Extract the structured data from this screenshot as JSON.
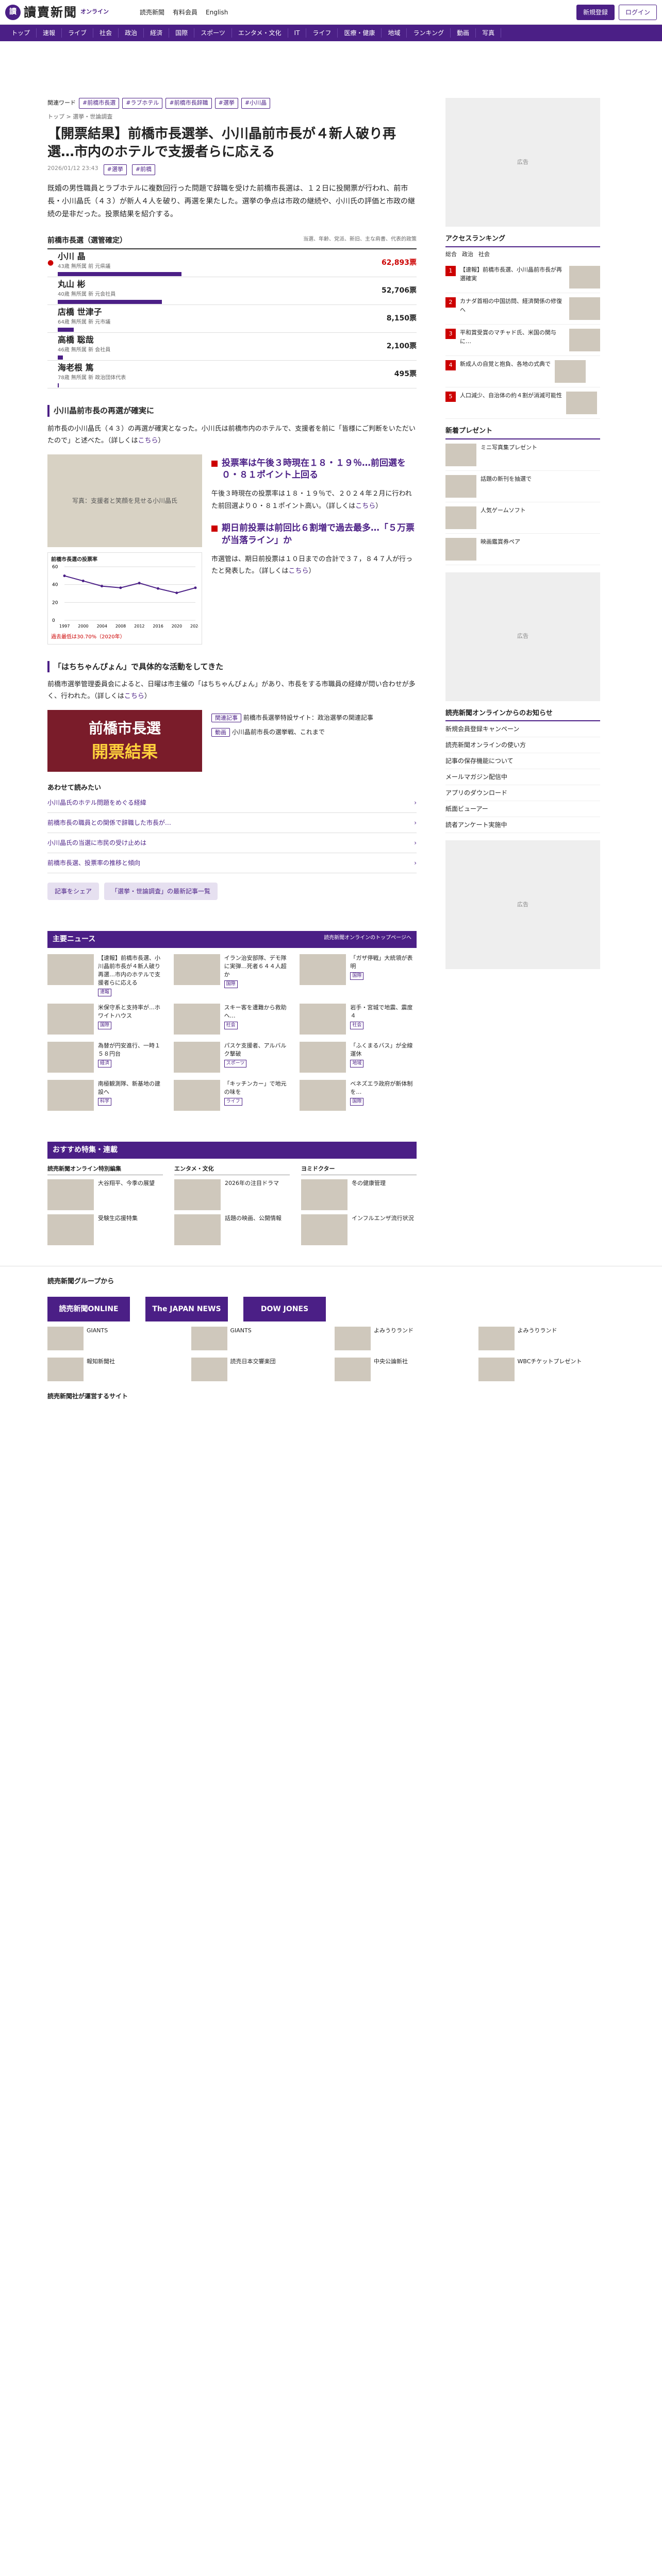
{
  "header": {
    "logo_mark": "讀",
    "logo": "讀賣新聞",
    "logo_sub": "オンライン",
    "links": [
      "読売新聞",
      "有料会員",
      "English"
    ],
    "login": "ログイン",
    "register": "新規登録"
  },
  "nav": [
    "トップ",
    "速報",
    "ライブ",
    "社会",
    "政治",
    "経済",
    "国際",
    "スポーツ",
    "エンタメ・文化",
    "IT",
    "ライフ",
    "医療・健康",
    "地域",
    "ランキング",
    "動画",
    "写真"
  ],
  "keywords": {
    "label": "関連ワード",
    "tags": [
      "#前橋市長選",
      "#ラブホテル",
      "#前橋市長辞職",
      "#選挙",
      "#小川晶"
    ]
  },
  "breadcrumb": "トップ > 選挙・世論調査",
  "title": "【開票結果】前橋市長選挙、小川晶前市長が４新人破り再選…市内のホテルで支援者らに応える",
  "meta": {
    "date": "2026/01/12 23:43",
    "tags": [
      "#選挙",
      "#前橋"
    ]
  },
  "lead": "既婚の男性職員とラブホテルに複数回行った問題で辞職を受けた前橋市長選は、１２日に投開票が行われ、前市長・小川晶氏（４３）が新人４人を破り、再選を果たした。選挙の争点は市政の継続や、小川氏の評価と市政の継続の是非だった。投票結果を紹介する。",
  "results": {
    "title": "前橋市長選（選管確定）",
    "note": "当選、年齢、党派、新旧、主な肩書、代表的政策",
    "candidates": [
      {
        "name": "小川 晶",
        "sub": "43歳 無所属 前 元県議",
        "votes": "62,893票",
        "pct": 100,
        "win": true
      },
      {
        "name": "丸山 彬",
        "sub": "40歳 無所属 新 元会社員",
        "votes": "52,706票",
        "pct": 84,
        "win": false
      },
      {
        "name": "店橋 世津子",
        "sub": "64歳 無所属 新 元市議",
        "votes": "8,150票",
        "pct": 13,
        "win": false
      },
      {
        "name": "高橋 聡哉",
        "sub": "46歳 無所属 新 会社員",
        "votes": "2,100票",
        "pct": 4,
        "win": false
      },
      {
        "name": "海老根 篤",
        "sub": "78歳 無所属 新 政治団体代表",
        "votes": "495票",
        "pct": 1,
        "win": false
      }
    ]
  },
  "sec1": {
    "heading": "小川晶前市長の再選が確実に",
    "text": "前市長の小川晶氏（４３）の再選が確実となった。小川氏は前橋市内のホテルで、支援者を前に「皆様にご判断をいただいたので」と述べた。（詳しくは",
    "link": "こちら",
    "close": "）"
  },
  "photo1": "写真：支援者と笑顔を見せる小川晶氏",
  "turnout": {
    "title": "投票率は午後３時現在１８・１９％…前回選を０・８１ポイント上回る",
    "text": "午後３時現在の投票率は１８・１９％で、２０２４年２月に行われた前回選より０・８１ポイント高い。（詳しくは",
    "link": "こちら",
    "close": "）",
    "title2": "期日前投票は前回比６割増で過去最多…「５万票が当落ライン」か",
    "text2": "市選管は、期日前投票は１０日までの合計で３７，８４７人が行ったと発表した。（詳しくは",
    "link2": "こちら",
    "close2": "）"
  },
  "chart_data": {
    "type": "line",
    "title": "前橋市長選の投票率",
    "x": [
      "1997",
      "2000",
      "2004",
      "2008",
      "2012",
      "2016",
      "2020",
      "2024"
    ],
    "values": [
      49.8,
      44.1,
      38.3,
      36.4,
      41.7,
      35.6,
      30.7,
      36.4
    ],
    "ylim": [
      0,
      60
    ],
    "annotation": "過去最低は30.70%（2020年）"
  },
  "sec2": {
    "heading": "「はちちゃんぴょん」で具体的な活動をしてきた",
    "text": "前橋市選挙管理委員会によると、日曜は市主催の「はちちゃんぴょん」があり、市長をする市職員の経緯が問い合わせが多く、行われた。（詳しくは",
    "link": "こちら",
    "close": "）"
  },
  "poster": {
    "line1": "前橋市長選",
    "line2": "開票結果"
  },
  "mini": [
    {
      "tag": "関連記事",
      "title": "前橋市長選挙特設サイト：政治選挙の関連記事"
    },
    {
      "tag": "動画",
      "title": "小川晶前市長の選挙戦、これまで"
    }
  ],
  "related": {
    "heading": "あわせて読みたい",
    "items": [
      "小川晶氏のホテル問題をめぐる経緯",
      "前橋市長の職員との関係で辞職した市長が…",
      "小川晶氏の当選に市民の受け止めは",
      "前橋市長選、投票率の推移と傾向"
    ]
  },
  "share": [
    "記事をシェア",
    "「選挙・世論調査」の最新記事一覧"
  ],
  "main_news": {
    "title": "主要ニュース",
    "more": "読売新聞オンラインのトップページへ",
    "items": [
      {
        "t": "【速報】前橋市長選、小川晶前市長が４新人破り再選…市内のホテルで支援者らに応える",
        "l": "速報"
      },
      {
        "t": "イラン治安部隊、デモ隊に実弾…死者６４４人超か",
        "l": "国際"
      },
      {
        "t": "「ガザ停戦」大統領が表明",
        "l": "国際"
      },
      {
        "t": "米保守系と支持率が…ホワイトハウス",
        "l": "国際"
      },
      {
        "t": "スキー客を遭難から救助へ…",
        "l": "社会"
      },
      {
        "t": "岩手・宮城で地震、震度４",
        "l": "社会"
      },
      {
        "t": "為替が円安進行、一時１５８円台",
        "l": "経済"
      },
      {
        "t": "パスケ支援者、アルバルク撃破",
        "l": "スポーツ"
      },
      {
        "t": "「ふくまるバス」が全線運休",
        "l": "地域"
      },
      {
        "t": "南極観測隊、新基地の建設へ",
        "l": "科学"
      },
      {
        "t": "「キッチンカー」で地元の味を",
        "l": "ライフ"
      },
      {
        "t": "ベネズエラ政府が新体制を…",
        "l": "国際"
      }
    ]
  },
  "reco": {
    "title": "おすすめ特集・連載",
    "cols": [
      {
        "hd": "読売新聞オンライン特別編集",
        "items": [
          "大谷翔平、今季の展望",
          "受験生応援特集"
        ]
      },
      {
        "hd": "エンタメ・文化",
        "items": [
          "2026年の注目ドラマ",
          "話題の映画、公開情報"
        ]
      },
      {
        "hd": "ヨミドクター",
        "items": [
          "冬の健康管理",
          "インフルエンザ流行状況"
        ]
      }
    ]
  },
  "ad": "広告",
  "side": {
    "ranking": "アクセスランキング",
    "tabs": [
      "総合",
      "政治",
      "社会"
    ],
    "rank": [
      {
        "n": "1",
        "t": "【速報】前橋市長選、小川晶前市長が再選確実"
      },
      {
        "n": "2",
        "t": "カナダ首相の中国訪問、経済関係の修復へ"
      },
      {
        "n": "3",
        "t": "平和賞受賞のマチャド氏、米国の関与に…"
      },
      {
        "n": "4",
        "t": "新成人の自覚と抱負、各地の式典で"
      },
      {
        "n": "5",
        "t": "人口減少、自治体の約４割が消滅可能性"
      }
    ],
    "present": "新着プレゼント",
    "pre": [
      "ミニ写真集プレゼント",
      "話題の新刊を抽選で",
      "人気ゲームソフト",
      "映画鑑賞券ペア"
    ],
    "pr": "読売新聞オンラインからのお知らせ",
    "prl": [
      "新規会員登録キャンペーン",
      "読売新聞オンラインの使い方",
      "記事の保存機能について",
      "メールマガジン配信中",
      "アプリのダウンロード",
      "紙面ビューアー",
      "読者アンケート実施中"
    ]
  },
  "footer": {
    "groups": "読売新聞グループから",
    "banners": [
      "読売新聞ONLINE",
      "The JAPAN NEWS",
      "DOW JONES"
    ],
    "items": [
      "GIANTS",
      "GIANTS",
      "よみうりランド",
      "よみうりランド",
      "報知新聞社",
      "読売日本交響楽団",
      "中央公論新社",
      "WBCチケットプレゼント"
    ],
    "bottom": "読売新聞社が運営するサイト"
  }
}
